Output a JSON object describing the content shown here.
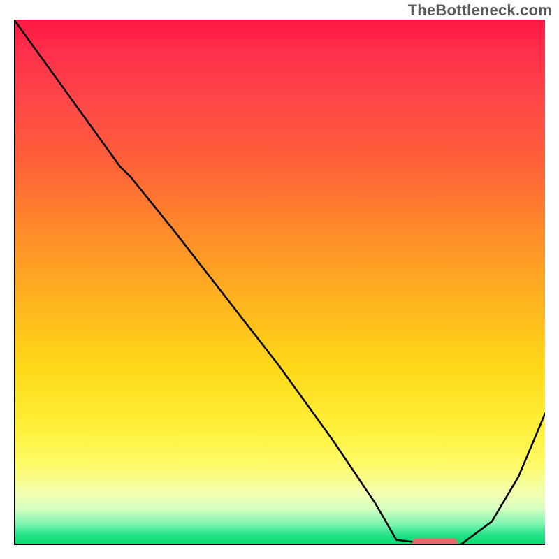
{
  "attribution": "TheBottleneck.com",
  "chart_data": {
    "type": "line",
    "title": "",
    "xlabel": "",
    "ylabel": "",
    "xlim": [
      0,
      100
    ],
    "ylim": [
      0,
      100
    ],
    "grid": false,
    "legend": false,
    "series": [
      {
        "name": "curve",
        "x": [
          0,
          5,
          10,
          15,
          20,
          22,
          30,
          40,
          50,
          60,
          68,
          72,
          80,
          84,
          90,
          95,
          100
        ],
        "y": [
          100,
          93,
          86,
          79,
          72,
          70,
          60,
          47,
          34,
          20,
          8,
          1,
          0,
          0,
          4.5,
          13,
          25
        ]
      }
    ],
    "marker": {
      "x_start": 75,
      "x_end": 83.5,
      "y": 0.6,
      "color": "#e26a6a"
    },
    "background_gradient_stops": [
      {
        "pos": 0,
        "color": "#ff1744"
      },
      {
        "pos": 16,
        "color": "#ff4848"
      },
      {
        "pos": 40,
        "color": "#ff8a2a"
      },
      {
        "pos": 66,
        "color": "#ffd818"
      },
      {
        "pos": 85,
        "color": "#fdfb6a"
      },
      {
        "pos": 93,
        "color": "#d8ffc0"
      },
      {
        "pos": 100,
        "color": "#06d86a"
      }
    ]
  }
}
